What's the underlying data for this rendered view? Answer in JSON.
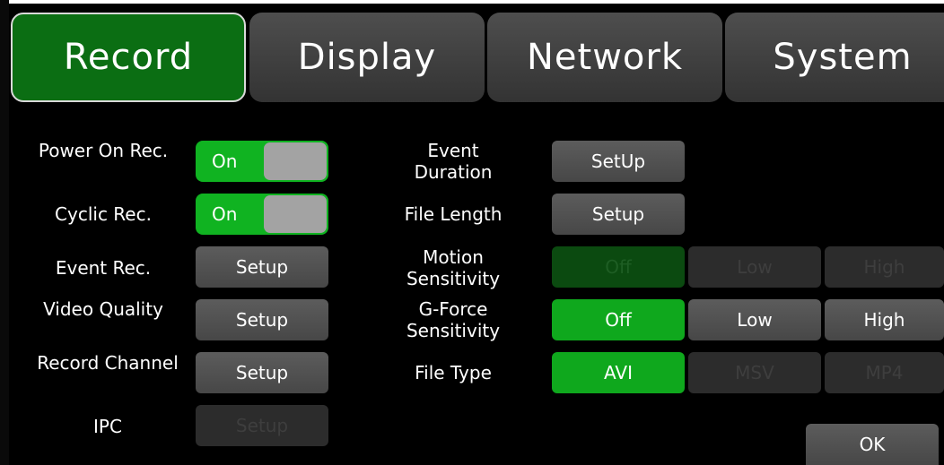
{
  "tabs": [
    {
      "label": "Record",
      "active": true
    },
    {
      "label": "Display",
      "active": false
    },
    {
      "label": "Network",
      "active": false
    },
    {
      "label": "System",
      "active": false
    }
  ],
  "left": {
    "power_on_rec": {
      "label": "Power On Rec.",
      "value": "On"
    },
    "cyclic_rec": {
      "label": "Cyclic Rec.",
      "value": "On"
    },
    "event_rec": {
      "label": "Event Rec.",
      "button": "Setup"
    },
    "video_quality": {
      "label": "Video Quality",
      "button": "Setup"
    },
    "record_channel": {
      "label": "Record Channel",
      "button": "Setup"
    },
    "ipc": {
      "label": "IPC",
      "button": "Setup",
      "enabled": false
    }
  },
  "right": {
    "event_duration": {
      "label": "Event Duration",
      "button": "SetUp"
    },
    "file_length": {
      "label": "File Length",
      "button": "Setup"
    },
    "motion_sensitivity": {
      "label": "Motion Sensitivity",
      "options": [
        "Off",
        "Low",
        "High"
      ],
      "selected": "Off",
      "enabled": false
    },
    "gforce_sensitivity": {
      "label": "G-Force Sensitivity",
      "options": [
        "Off",
        "Low",
        "High"
      ],
      "selected": "Off"
    },
    "file_type": {
      "label": "File Type",
      "options": [
        "AVI",
        "MSV",
        "MP4"
      ],
      "selected": "AVI"
    }
  },
  "ok_label": "OK",
  "colors": {
    "accent_green": "#0fa81d",
    "tab_active": "#0b6e13",
    "background": "#000000"
  }
}
